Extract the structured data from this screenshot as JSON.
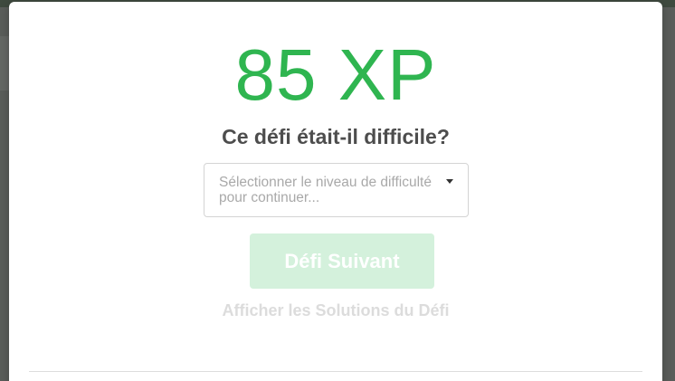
{
  "reward": {
    "xp_text": "85 XP"
  },
  "question": "Ce défi était-il difficile?",
  "difficulty_select": {
    "placeholder": "Sélectionner le niveau de difficulté pour continuer..."
  },
  "next_button_label": "Défi Suivant",
  "solutions_link_label": "Afficher les Solutions du Défi",
  "colors": {
    "accent_green": "#2fb550",
    "disabled_button": "#d4f1dc"
  },
  "icons": {
    "select_caret": "caret-down-icon"
  }
}
